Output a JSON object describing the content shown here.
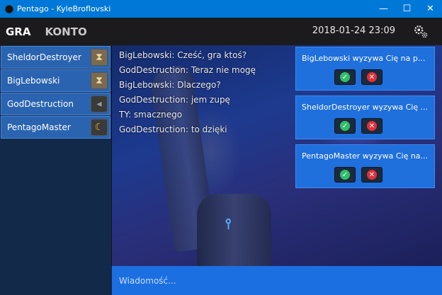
{
  "window": {
    "title": "Pentago - KyleBroflovski",
    "minimize": "—",
    "maximize": "☐",
    "close": "✕"
  },
  "nav": {
    "tabs": [
      {
        "label": "GRA",
        "active": true
      },
      {
        "label": "KONTO",
        "active": false
      }
    ],
    "datetime": "2018-01-24 23:09"
  },
  "players": [
    {
      "name": "SheldorDestroyer",
      "status_icon": "hourglass-icon"
    },
    {
      "name": "BigLebowski",
      "status_icon": "hourglass-icon"
    },
    {
      "name": "GodDestruction",
      "status_icon": "idle-icon"
    },
    {
      "name": "PentagoMaster",
      "status_icon": "moon-icon"
    }
  ],
  "chat": [
    "BigLebowski: Cześć, gra ktoś?",
    "GodDestruction: Teraz nie mogę",
    "BigLebowski: Dlaczego?",
    "GodDestruction: jem zupę",
    "TY: smacznego",
    "GodDestruction: to dzięki"
  ],
  "challenges": [
    {
      "message": "BigLebowski wyzywa Cię na p..."
    },
    {
      "message": "SheldorDestroyer wyzywa Cię ..."
    },
    {
      "message": "PentagoMaster wyzywa Cię na..."
    }
  ],
  "input": {
    "placeholder": "Wiadomość..."
  },
  "colors": {
    "titlebar": "#0078d7",
    "accent": "#1f6fdc",
    "accept": "#2fbf6a",
    "reject": "#e0303a"
  }
}
